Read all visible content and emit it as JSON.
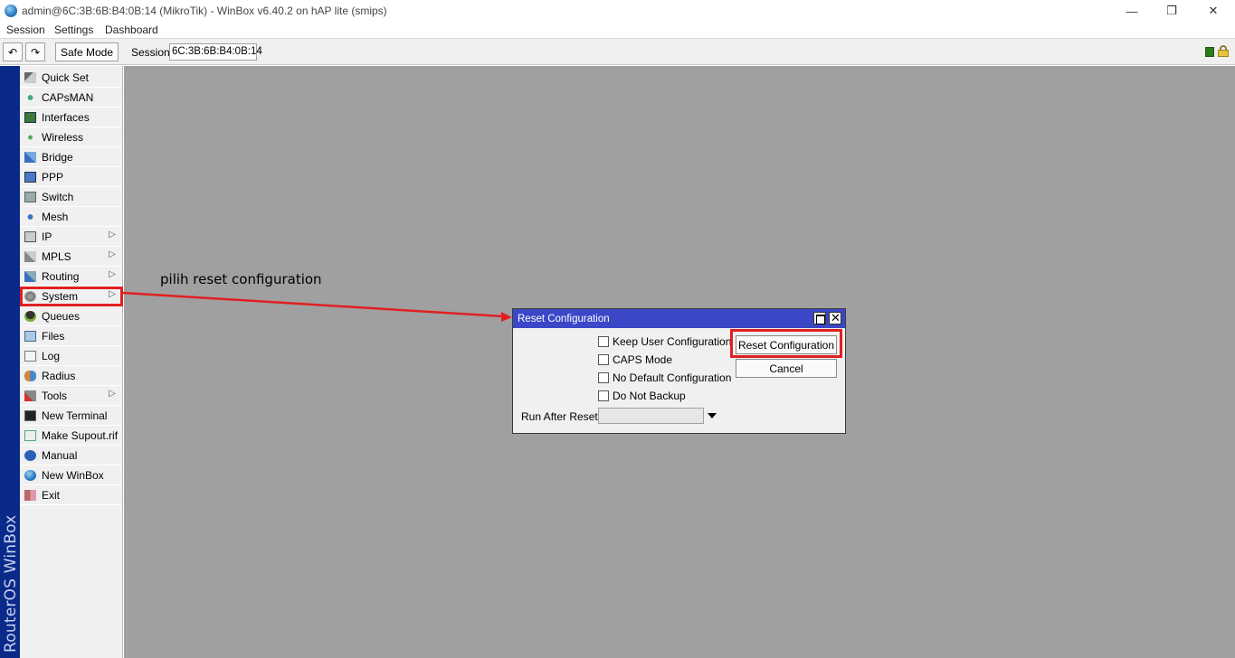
{
  "window": {
    "title": "admin@6C:3B:6B:B4:0B:14 (MikroTik) - WinBox v6.40.2 on hAP lite (smips)",
    "min_glyph": "—",
    "max_glyph": "❐",
    "close_glyph": "✕"
  },
  "menubar": {
    "items": [
      "Session",
      "Settings",
      "Dashboard"
    ]
  },
  "toolbar": {
    "undo_glyph": "↶",
    "redo_glyph": "↷",
    "safe_mode_label": "Safe Mode",
    "session_label": "Session:",
    "session_value": "6C:3B:6B:B4:0B:14",
    "status_color": "#2a7d16"
  },
  "brand": {
    "text": "RouterOS WinBox",
    "color": "#0a2a8a"
  },
  "sidebar": {
    "items": [
      {
        "label": "Quick Set",
        "icon": "quick-set-icon",
        "submenu": false
      },
      {
        "label": "CAPsMAN",
        "icon": "capsman-icon",
        "submenu": false
      },
      {
        "label": "Interfaces",
        "icon": "interfaces-icon",
        "submenu": false
      },
      {
        "label": "Wireless",
        "icon": "wireless-icon",
        "submenu": false
      },
      {
        "label": "Bridge",
        "icon": "bridge-icon",
        "submenu": false
      },
      {
        "label": "PPP",
        "icon": "ppp-icon",
        "submenu": false
      },
      {
        "label": "Switch",
        "icon": "switch-icon",
        "submenu": false
      },
      {
        "label": "Mesh",
        "icon": "mesh-icon",
        "submenu": false
      },
      {
        "label": "IP",
        "icon": "ip-icon",
        "submenu": true
      },
      {
        "label": "MPLS",
        "icon": "mpls-icon",
        "submenu": true
      },
      {
        "label": "Routing",
        "icon": "routing-icon",
        "submenu": true
      },
      {
        "label": "System",
        "icon": "system-icon",
        "submenu": true
      },
      {
        "label": "Queues",
        "icon": "queues-icon",
        "submenu": false
      },
      {
        "label": "Files",
        "icon": "files-icon",
        "submenu": false
      },
      {
        "label": "Log",
        "icon": "log-icon",
        "submenu": false
      },
      {
        "label": "Radius",
        "icon": "radius-icon",
        "submenu": false
      },
      {
        "label": "Tools",
        "icon": "tools-icon",
        "submenu": true
      },
      {
        "label": "New Terminal",
        "icon": "terminal-icon",
        "submenu": false
      },
      {
        "label": "Make Supout.rif",
        "icon": "supout-icon",
        "submenu": false
      },
      {
        "label": "Manual",
        "icon": "manual-icon",
        "submenu": false
      },
      {
        "label": "New WinBox",
        "icon": "winbox-icon",
        "submenu": false
      },
      {
        "label": "Exit",
        "icon": "exit-icon",
        "submenu": false
      }
    ],
    "submenu_glyph": "▷"
  },
  "annotation": {
    "text": "pilih reset configuration",
    "color": "#e02020"
  },
  "dialog": {
    "title": "Reset Configuration",
    "close_glyph": "✕",
    "checkboxes": [
      {
        "label": "Keep User Configuration",
        "checked": false
      },
      {
        "label": "CAPS Mode",
        "checked": false
      },
      {
        "label": "No Default Configuration",
        "checked": false
      },
      {
        "label": "Do Not Backup",
        "checked": false
      }
    ],
    "reset_button": "Reset Configuration",
    "cancel_button": "Cancel",
    "run_after_reset_label": "Run After Reset:",
    "run_after_reset_value": ""
  }
}
